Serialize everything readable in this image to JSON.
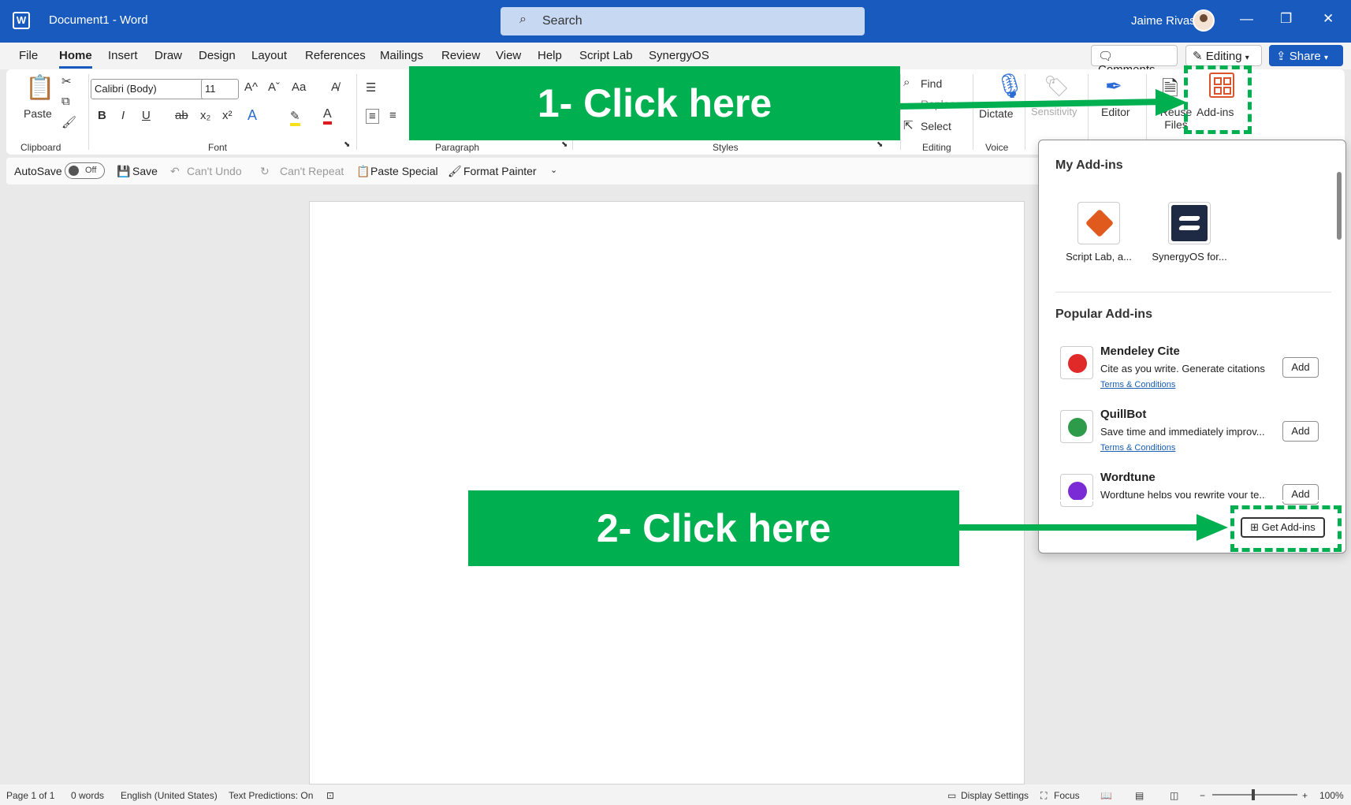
{
  "titlebar": {
    "app_icon": "W",
    "title": "Document1  -  Word",
    "search_placeholder": "Search",
    "user_name": "Jaime Rivas",
    "minimize_glyph": "—",
    "restore_glyph": "❐",
    "close_glyph": "✕"
  },
  "tabs": [
    "File",
    "Home",
    "Insert",
    "Draw",
    "Design",
    "Layout",
    "References",
    "Mailings",
    "Review",
    "View",
    "Help",
    "Script Lab",
    "SynergyOS"
  ],
  "top_buttons": {
    "comments": "Comments",
    "editing": "Editing",
    "share": "Share"
  },
  "ribbon": {
    "clipboard": {
      "paste": "Paste",
      "label": "Clipboard"
    },
    "font": {
      "family": "Calibri (Body)",
      "size": "11",
      "grow": "A^",
      "shrink": "Aˇ",
      "change_case": "Aa",
      "bold": "B",
      "italic": "I",
      "underline": "U",
      "strike": "ab",
      "subscript": "x₂",
      "superscript": "x²",
      "effects": "A",
      "highlight": "✎",
      "color": "A",
      "label": "Font"
    },
    "paragraph": {
      "label": "Paragraph"
    },
    "styles": {
      "label": "Styles"
    },
    "editing": {
      "find": "Find",
      "replace": "Replace",
      "select": "Select",
      "label": "Editing"
    },
    "voice": {
      "dictate": "Dictate",
      "label": "Voice"
    },
    "sensitivity": "Sensitivity",
    "editor": "Editor",
    "reuse_files": "Reuse Files",
    "addins": "Add-ins"
  },
  "qat": {
    "autosave": "AutoSave",
    "autosave_state": "Off",
    "save": "Save",
    "undo": "Can't Undo",
    "repeat": "Can't Repeat",
    "paste_special": "Paste Special",
    "format_painter": "Format Painter"
  },
  "panel": {
    "my_addins_heading": "My Add-ins",
    "my_addins": [
      {
        "label": "Script Lab, a..."
      },
      {
        "label": "SynergyOS for..."
      }
    ],
    "popular_heading": "Popular Add-ins",
    "popular": [
      {
        "name": "Mendeley Cite",
        "desc": "Cite as you write. Generate citations...",
        "terms": "Terms & Conditions",
        "button": "Add"
      },
      {
        "name": "QuillBot",
        "desc": "Save time and immediately improv...",
        "terms": "Terms & Conditions",
        "button": "Add"
      },
      {
        "name": "Wordtune",
        "desc": "Wordtune helps you rewrite your te...",
        "button": "Add"
      }
    ],
    "get_addins": "Get Add-ins"
  },
  "statusbar": {
    "page": "Page 1 of 1",
    "words": "0 words",
    "language": "English (United States)",
    "predictions": "Text Predictions: On",
    "display_settings": "Display Settings",
    "focus": "Focus",
    "zoom": "100%"
  },
  "callouts": {
    "step1": "1- Click here",
    "step2": "2- Click here"
  },
  "colors": {
    "titlebar": "#185abd",
    "callout_green": "#00b050",
    "addins_icon": "#d9532b"
  }
}
